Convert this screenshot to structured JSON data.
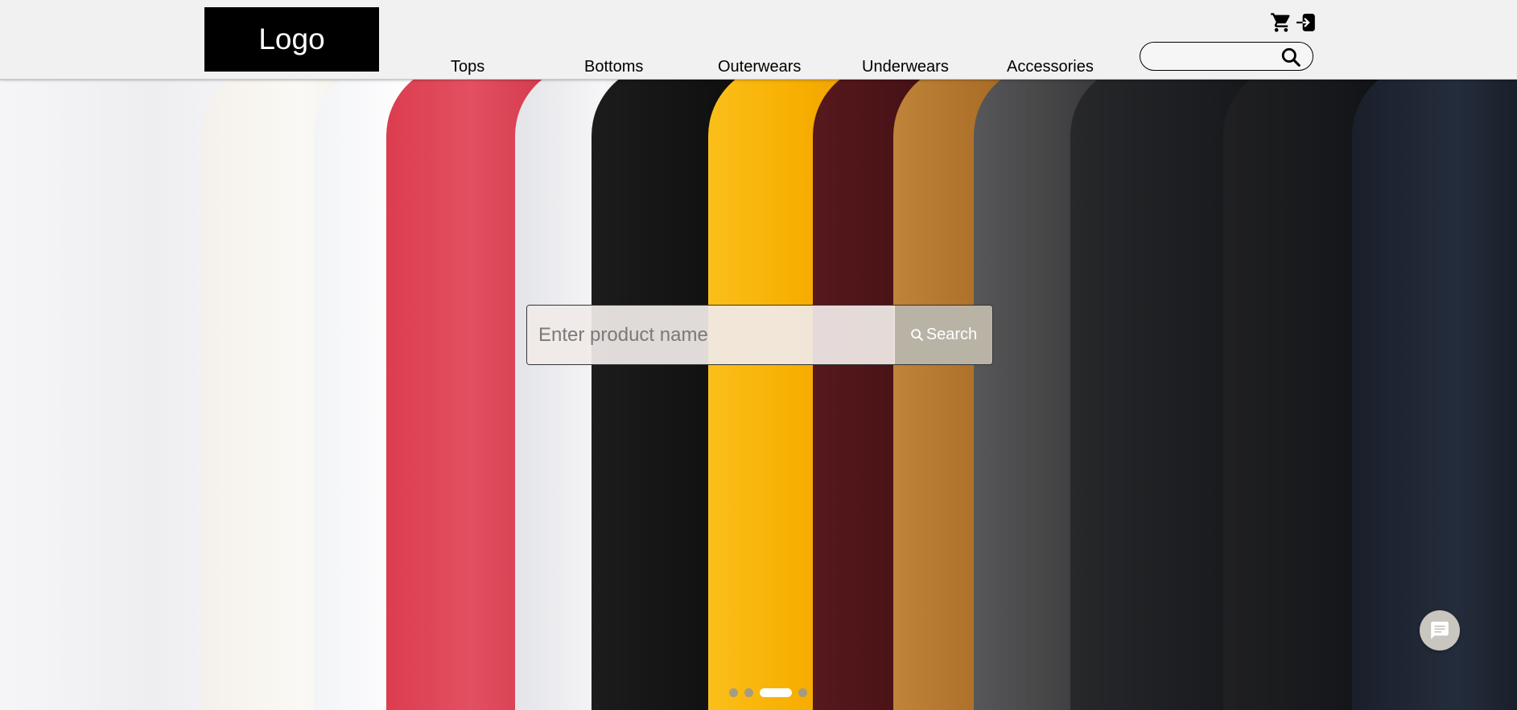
{
  "header": {
    "logo_text": "Logo",
    "nav": [
      {
        "label": "Tops"
      },
      {
        "label": "Bottoms"
      },
      {
        "label": "Outerwears"
      },
      {
        "label": "Underwears"
      },
      {
        "label": "Accessories"
      }
    ],
    "icons": [
      "cart-icon",
      "login-icon",
      "search-icon"
    ],
    "search": {
      "value": "",
      "placeholder": ""
    }
  },
  "hero": {
    "image": "clothing-rack-photo",
    "search": {
      "placeholder": "Enter product name",
      "value": "",
      "button_label": "Search"
    },
    "carousel": {
      "slides": 4,
      "active_index": 2
    }
  },
  "chat": {
    "icon": "chat-icon"
  },
  "colors": {
    "header_bg": "#f1f1f1",
    "logo_bg": "#000000",
    "search_button": "#b9b3a6",
    "chat_button": "#c9c5bf"
  }
}
